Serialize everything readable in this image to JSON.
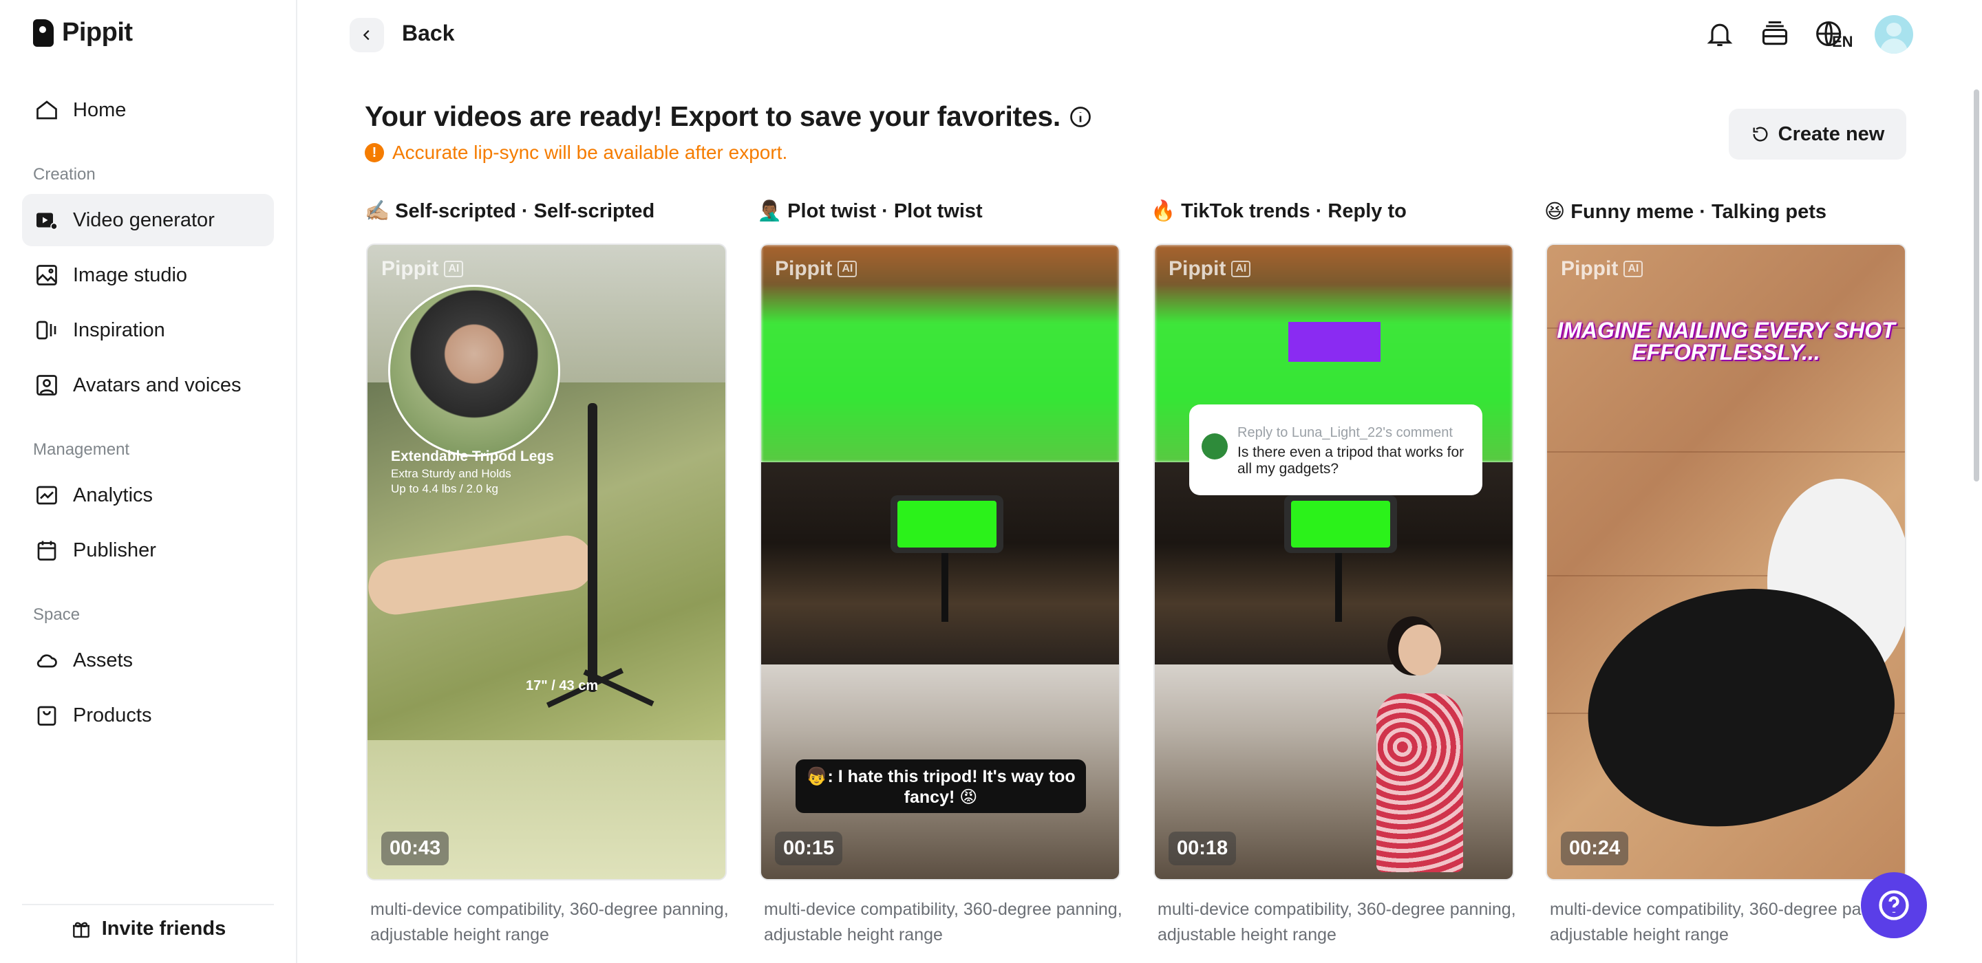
{
  "app": {
    "name": "Pippit"
  },
  "sidebar": {
    "home": "Home",
    "sections": {
      "creation": "Creation",
      "management": "Management",
      "space": "Space"
    },
    "items": {
      "video_generator": "Video generator",
      "image_studio": "Image studio",
      "inspiration": "Inspiration",
      "avatars_voices": "Avatars and voices",
      "analytics": "Analytics",
      "publisher": "Publisher",
      "assets": "Assets",
      "products": "Products"
    },
    "active": "Video generator",
    "invite": "Invite friends"
  },
  "header": {
    "back": "Back",
    "lang": "EN",
    "icons": [
      "bell-icon",
      "stack-icon",
      "globe-icon",
      "avatar"
    ]
  },
  "main": {
    "title": "Your videos are ready! Export to save your favorites.",
    "notice": "Accurate lip-sync will be available after export.",
    "notice_mark": "!",
    "create_new": "Create new"
  },
  "cards": [
    {
      "emoji": "✍🏼",
      "title": "Self-scripted · Self-scripted",
      "duration": "00:43",
      "desc": "multi-device compatibility, 360-degree panning, adjustable height range",
      "overlay": {
        "heading": "Extendable Tripod Legs",
        "line1": "Extra Sturdy and Holds",
        "line2": "Up to 4.4 lbs / 2.0 kg",
        "measure": "17\" / 43 cm"
      }
    },
    {
      "emoji": "🤦🏾‍♂️",
      "title": "Plot twist · Plot twist",
      "duration": "00:15",
      "desc": "multi-device compatibility, 360-degree panning, adjustable height range",
      "overlay": {
        "subtitle": "👦: I hate this tripod! It's way too fancy! 😡"
      }
    },
    {
      "emoji": "🔥",
      "title": "TikTok trends · Reply to",
      "duration": "00:18",
      "desc": "multi-device compatibility, 360-degree panning, adjustable height range",
      "overlay": {
        "reply_to": "Reply to Luna_Light_22's comment",
        "comment": "Is there even a tripod that works for all my gadgets?"
      }
    },
    {
      "emoji": "😆",
      "title": "Funny meme · Talking pets",
      "duration": "00:24",
      "desc": "multi-device compatibility, 360-degree panning, adjustable height range",
      "overlay": {
        "caption": "IMAGINE NAILING EVERY SHOT EFFORTLESSLY..."
      }
    }
  ],
  "watermark": {
    "brand": "Pippit",
    "badge": "AI"
  },
  "colors": {
    "accent": "#5a3ee8",
    "warning": "#f57c00",
    "active_bg": "#f1f2f4"
  }
}
